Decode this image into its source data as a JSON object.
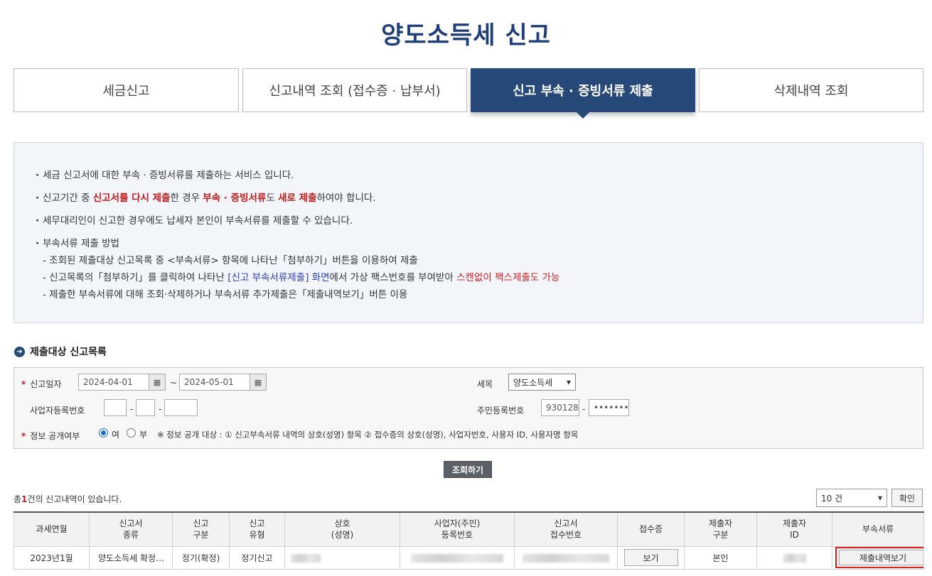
{
  "page_title": "양도소득세 신고",
  "tabs": [
    {
      "label": "세금신고",
      "active": false
    },
    {
      "label": "신고내역 조회 (접수증 · 납부서)",
      "active": false
    },
    {
      "label": "신고 부속 · 증빙서류 제출",
      "active": true
    },
    {
      "label": "삭제내역 조회",
      "active": false
    }
  ],
  "notice": {
    "line1": "세금 신고서에 대한 부속 · 증빙서류를 제출하는 서비스 입니다.",
    "line2": {
      "a": "신고기간 중 ",
      "b": "신고서를 다시 제출",
      "c": "한 경우 ",
      "d": "부속 · 증빙서류",
      "e": "도 ",
      "f": "새로 제출",
      "g": "하여야 합니다."
    },
    "line3": "세무대리인이 신고한 경우에도 납세자 본인이 부속서류를 제출할 수 있습니다.",
    "line4": "부속서류 제출 방법",
    "sub1": "- 조회된 제출대상 신고목록 중 <부속서류> 항목에 나타난「첨부하기」버튼을 이용하여 제출",
    "sub2": {
      "a": "- 신고목록의「첨부하기」를 클릭하여 나타난 ",
      "b": "[신고 부속서류제출] 화면",
      "c": "에서 가상 팩스번호를 부여받아 ",
      "d": "스캔없이 팩스제출도 가능"
    },
    "sub3": "- 제출한 부속서류에 대해 조회·삭제하거나 부속서류 추가제출은「제출내역보기」버튼 이용"
  },
  "section_title": "제출대상 신고목록",
  "search": {
    "date_label": "신고일자",
    "date_from": "2024-04-01",
    "date_tilde": "~",
    "date_to": "2024-05-01",
    "tax_label": "세목",
    "tax_value": "양도소득세",
    "biz_label": "사업자등록번호",
    "resident_label": "주민등록번호",
    "resident_front": "930128",
    "resident_back": "•••••••",
    "dash": "-",
    "disclose_label": "정보 공개여부",
    "radio_yes": "여",
    "radio_no": "부",
    "disclose_note": "※ 정보 공개 대상 : ① 신고부속서류 내역의 상호(성명) 항목 ② 접수증의 상호(성명), 사업자번호, 사용자 ID, 사용자명 항목"
  },
  "search_button": "조회하기",
  "total": {
    "prefix": "총",
    "count": "1",
    "suffix": "건의 신고내역이 있습니다."
  },
  "page_size": "10 건",
  "confirm_button": "확인",
  "table": {
    "headers": [
      "과세연월",
      "신고서\n종류",
      "신고\n구분",
      "신고\n유형",
      "상호\n(성명)",
      "사업자(주민)\n등록번호",
      "신고서\n접수번호",
      "접수증",
      "제출자\n구분",
      "제출자\nID",
      "부속서류"
    ],
    "row": {
      "period": "2023년1월",
      "form_type": "양도소득세 확정신고",
      "report_div": "정기(확정)",
      "report_type": "정기신고",
      "receipt_button": "보기",
      "submitter_div": "본인",
      "attach_button": "제출내역보기"
    }
  }
}
